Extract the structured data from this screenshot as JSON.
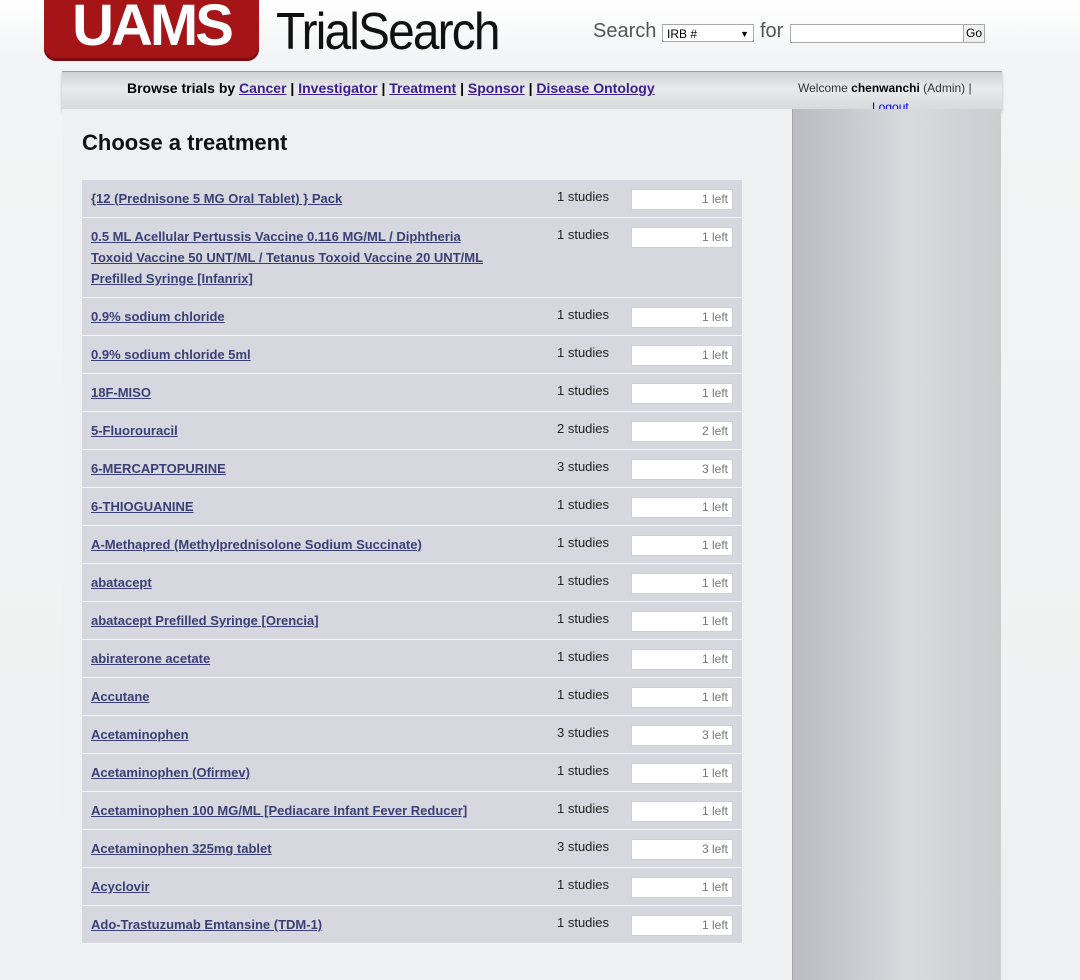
{
  "header": {
    "logo_text": "UAMS",
    "app_title": "TrialSearch",
    "search_label": "Search",
    "search_type": "IRB #",
    "for_label": "for",
    "search_value": "",
    "go_label": "Go"
  },
  "nav": {
    "browse_prefix": "Browse trials by",
    "links": [
      "Cancer",
      "Investigator",
      "Treatment",
      "Sponsor",
      "Disease Ontology"
    ],
    "separator": "|",
    "welcome_prefix": "Welcome",
    "username": "chenwanchi",
    "role": "(Admin) |",
    "logout": "Logout"
  },
  "page_title": "Choose a treatment",
  "treatments": [
    {
      "name": "{12 (Prednisone 5 MG Oral Tablet) } Pack",
      "studies": "1 studies",
      "left": "1 left"
    },
    {
      "name": "0.5 ML Acellular Pertussis Vaccine 0.116 MG/ML / Diphtheria Toxoid Vaccine 50 UNT/ML / Tetanus Toxoid Vaccine 20 UNT/ML Prefilled Syringe [Infanrix]",
      "studies": "1 studies",
      "left": "1 left"
    },
    {
      "name": "0.9% sodium chloride",
      "studies": "1 studies",
      "left": "1 left"
    },
    {
      "name": "0.9% sodium chloride 5ml",
      "studies": "1 studies",
      "left": "1 left"
    },
    {
      "name": "18F-MISO",
      "studies": "1 studies",
      "left": "1 left"
    },
    {
      "name": "5-Fluorouracil",
      "studies": "2 studies",
      "left": "2 left"
    },
    {
      "name": "6-MERCAPTOPURINE",
      "studies": "3 studies",
      "left": "3 left"
    },
    {
      "name": "6-THIOGUANINE",
      "studies": "1 studies",
      "left": "1 left"
    },
    {
      "name": "A-Methapred (Methylprednisolone Sodium Succinate)",
      "studies": "1 studies",
      "left": "1 left"
    },
    {
      "name": "abatacept",
      "studies": "1 studies",
      "left": "1 left"
    },
    {
      "name": "abatacept Prefilled Syringe [Orencia]",
      "studies": "1 studies",
      "left": "1 left"
    },
    {
      "name": "abiraterone acetate",
      "studies": "1 studies",
      "left": "1 left"
    },
    {
      "name": "Accutane",
      "studies": "1 studies",
      "left": "1 left"
    },
    {
      "name": "Acetaminophen",
      "studies": "3 studies",
      "left": "3 left"
    },
    {
      "name": "Acetaminophen (Ofirmev)",
      "studies": "1 studies",
      "left": "1 left"
    },
    {
      "name": "Acetaminophen 100 MG/ML [Pediacare Infant Fever Reducer]",
      "studies": "1 studies",
      "left": "1 left"
    },
    {
      "name": "Acetaminophen 325mg tablet",
      "studies": "3 studies",
      "left": "3 left"
    },
    {
      "name": "Acyclovir",
      "studies": "1 studies",
      "left": "1 left"
    },
    {
      "name": "Ado-Trastuzumab Emtansine (TDM-1)",
      "studies": "1 studies",
      "left": "1 left"
    }
  ]
}
